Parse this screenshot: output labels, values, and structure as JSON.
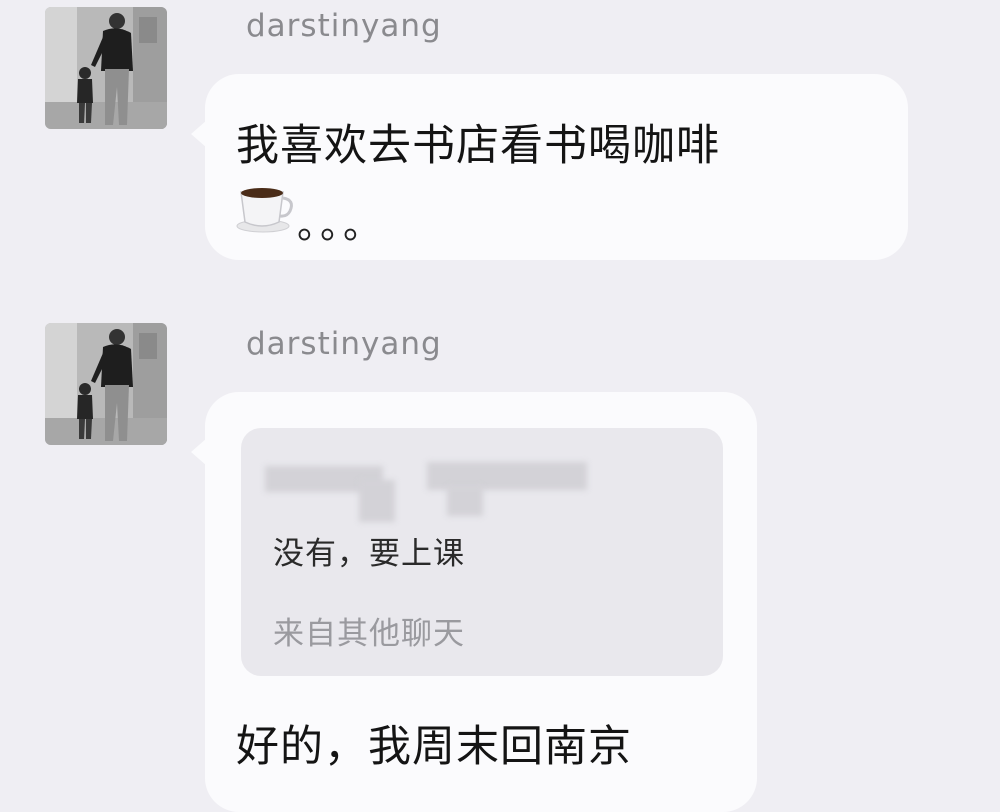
{
  "messages": [
    {
      "sender": "darstinyang",
      "text_line1": "我喜欢去书店看书喝咖啡",
      "emoji_icon": "coffee-cup-icon",
      "ellipsis": "。。。"
    },
    {
      "sender": "darstinyang",
      "quote": {
        "text": "没有，要上课",
        "source": "来自其他聊天"
      },
      "text": "好的，我周末回南京"
    }
  ]
}
